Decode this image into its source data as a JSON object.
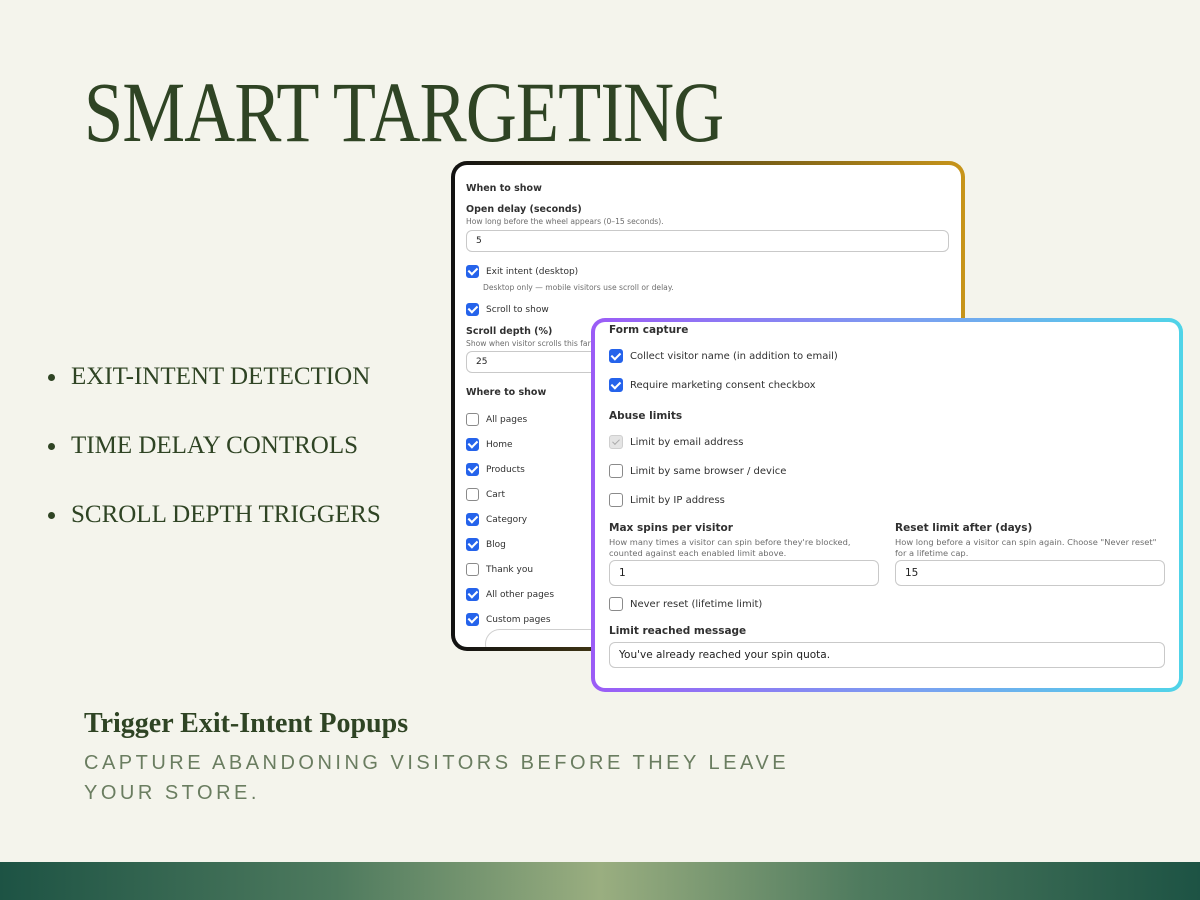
{
  "headline": "SMART TARGETING",
  "features": [
    "EXIT-INTENT DETECTION",
    "TIME DELAY CONTROLS",
    "SCROLL DEPTH TRIGGERS"
  ],
  "subhead": "Trigger Exit-Intent Popups",
  "tagline": "CAPTURE ABANDONING VISITORS BEFORE THEY LEAVE YOUR STORE.",
  "colors": {
    "background": "#f4f4ec",
    "text_green": "#2f4424",
    "checkbox_blue": "#2563eb"
  },
  "when_panel": {
    "section_title": "When to show",
    "open_delay": {
      "label": "Open delay (seconds)",
      "help": "How long before the wheel appears (0–15 seconds).",
      "value": "5"
    },
    "exit_intent": {
      "label": "Exit intent (desktop)",
      "checked": true,
      "help": "Desktop only — mobile visitors use scroll or delay."
    },
    "scroll_to_show": {
      "label": "Scroll to show",
      "checked": true
    },
    "scroll_depth": {
      "label": "Scroll depth (%)",
      "help": "Show when visitor scrolls this far dow",
      "value": "25"
    },
    "where_title": "Where to show",
    "pages": [
      {
        "label": "All pages",
        "checked": false
      },
      {
        "label": "Home",
        "checked": true
      },
      {
        "label": "Products",
        "checked": true
      },
      {
        "label": "Cart",
        "checked": false
      },
      {
        "label": "Category",
        "checked": true
      },
      {
        "label": "Blog",
        "checked": true
      },
      {
        "label": "Thank you",
        "checked": false
      },
      {
        "label": "All other pages",
        "checked": true
      },
      {
        "label": "Custom pages",
        "checked": true
      }
    ]
  },
  "form_panel": {
    "form_capture_title": "Form capture",
    "collect_name": {
      "label": "Collect visitor name (in addition to email)",
      "checked": true
    },
    "require_consent": {
      "label": "Require marketing consent checkbox",
      "checked": true
    },
    "abuse_title": "Abuse limits",
    "limit_email": {
      "label": "Limit by email address",
      "checked": true,
      "disabled": true
    },
    "limit_browser": {
      "label": "Limit by same browser / device",
      "checked": false
    },
    "limit_ip": {
      "label": "Limit by IP address",
      "checked": false
    },
    "max_spins": {
      "label": "Max spins per visitor",
      "help": "How many times a visitor can spin before they're blocked, counted against each enabled limit above.",
      "value": "1"
    },
    "reset_limit": {
      "label": "Reset limit after (days)",
      "help": "How long before a visitor can spin again. Choose \"Never reset\" for a lifetime cap.",
      "value": "15"
    },
    "never_reset": {
      "label": "Never reset (lifetime limit)",
      "checked": false
    },
    "limit_message": {
      "label": "Limit reached message",
      "value": "You've already reached your spin quota."
    }
  }
}
